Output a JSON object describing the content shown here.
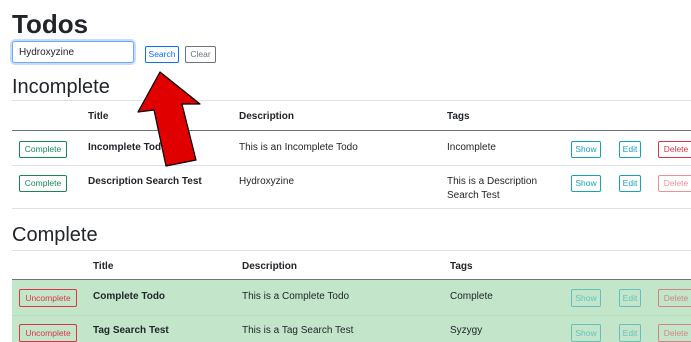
{
  "page": {
    "title": "Todos"
  },
  "search": {
    "value": "Hydroxyzine",
    "search_label": "Search",
    "clear_label": "Clear"
  },
  "incomplete": {
    "heading": "Incomplete",
    "columns": {
      "title": "Title",
      "description": "Description",
      "tags": "Tags"
    },
    "rows": [
      {
        "action": "Complete",
        "title": "Incomplete Todo",
        "description": "This is an Incomplete Todo",
        "tags_line1": "Incomplete",
        "tags_line2": ""
      },
      {
        "action": "Complete",
        "title": "Description Search Test",
        "description": "Hydroxyzine",
        "tags_line1": "This is a Description",
        "tags_line2": "Search Test"
      }
    ]
  },
  "complete": {
    "heading": "Complete",
    "columns": {
      "title": "Title",
      "description": "Description",
      "tags": "Tags"
    },
    "rows": [
      {
        "action": "Uncomplete",
        "title": "Complete Todo",
        "description": "This is a Complete Todo",
        "tags": "Complete"
      },
      {
        "action": "Uncomplete",
        "title": "Tag Search Test",
        "description": "This is a Tag Search Test",
        "tags": "Syzygy"
      }
    ]
  },
  "row_buttons": {
    "show": "Show",
    "edit": "Edit",
    "delete": "Delete"
  },
  "colors": {
    "primary": "#0d6efd",
    "success": "#198754",
    "danger": "#dc3545",
    "info": "#17a2b8",
    "complete_row": "#c3e6cb",
    "arrow": "#e00000"
  }
}
